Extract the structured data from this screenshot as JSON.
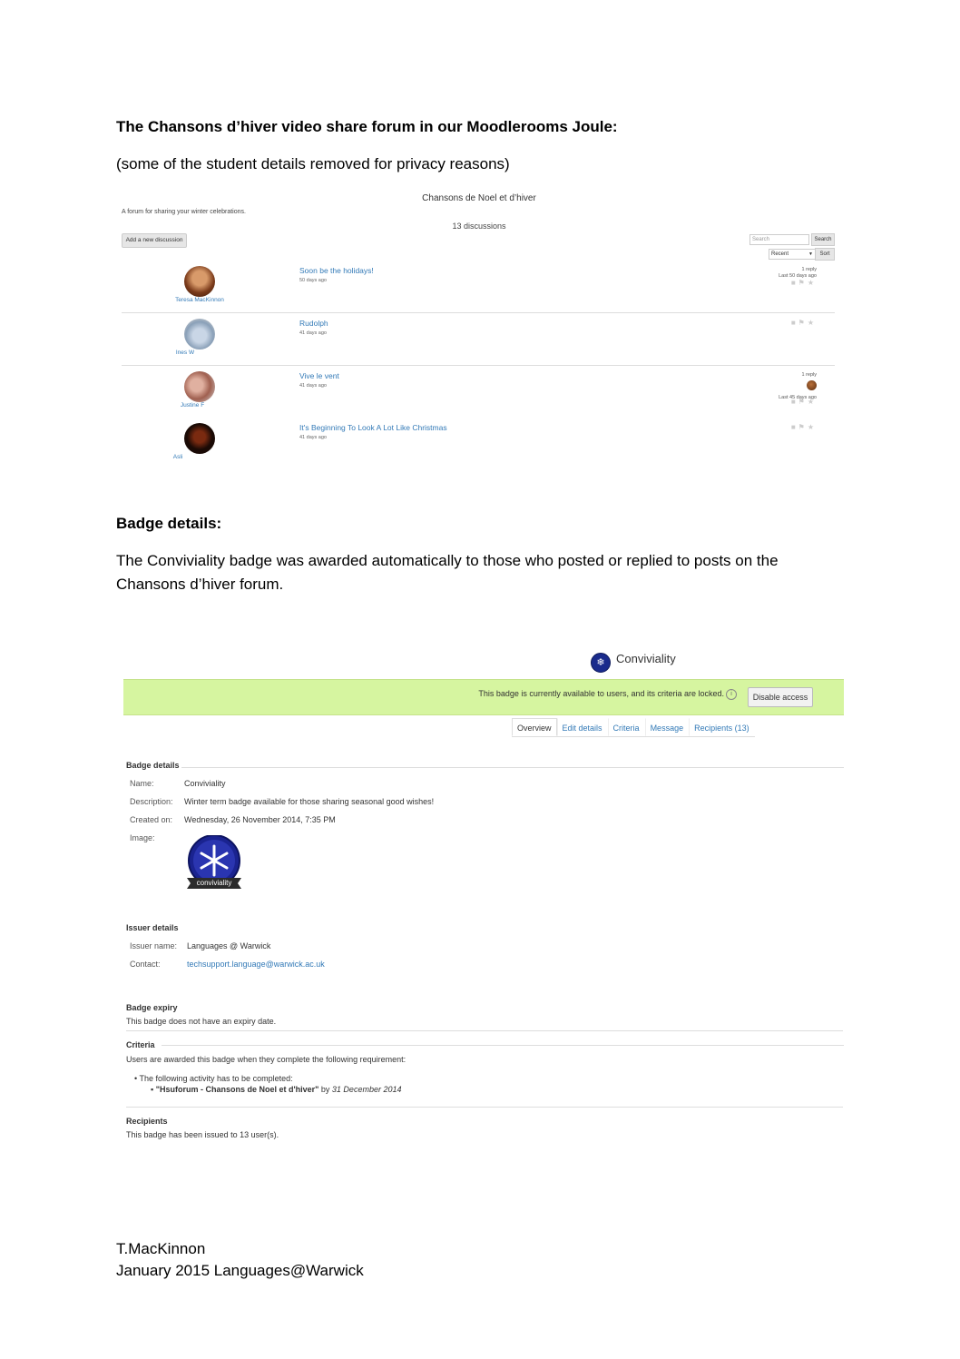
{
  "heading1": "The Chansons d’hiver video share forum in our Moodlerooms Joule:",
  "subheading1": "(some of the student details removed for privacy reasons)",
  "forum": {
    "title": "Chansons de Noel et d’hiver",
    "description": "A forum for sharing your winter celebrations.",
    "discussion_count": "13 discussions",
    "add_button": "Add a new discussion",
    "search_placeholder": "Search",
    "search_button": "Search",
    "sort_value": "Recent",
    "sort_button": "Sort",
    "discussions": [
      {
        "author": "Teresa MacKinnon",
        "title": "Soon be the holidays!",
        "ago": "50 days ago",
        "replies": "1 reply",
        "last": "Last 50 days ago"
      },
      {
        "author": "Ines W",
        "title": "Rudolph",
        "ago": "41 days ago",
        "replies": "",
        "last": ""
      },
      {
        "author": "Justine F",
        "title": "Vive le vent",
        "ago": "41 days ago",
        "replies": "1 reply",
        "last": "Last 45 days ago"
      },
      {
        "author": "Asli",
        "title": "It's Beginning To Look A Lot Like Christmas",
        "ago": "41 days ago",
        "replies": "",
        "last": ""
      }
    ]
  },
  "heading2": "Badge details:",
  "paragraph": "The Conviviality badge was awarded automatically to those who posted or replied to posts on the Chansons d’hiver forum.",
  "badge": {
    "title": "Conviviality",
    "status_message": "This badge is currently available to users, and its criteria are locked.",
    "disable_button": "Disable access",
    "tabs": [
      "Overview",
      "Edit details",
      "Criteria",
      "Message",
      "Recipients (13)"
    ],
    "details_heading": "Badge details",
    "name_label": "Name:",
    "name_value": "Conviviality",
    "description_label": "Description:",
    "description_value": "Winter term badge available for those sharing seasonal good wishes!",
    "created_label": "Created on:",
    "created_value": "Wednesday, 26 November 2014, 7:35 PM",
    "image_label": "Image:",
    "image_caption": "conviviality",
    "issuer_heading": "Issuer details",
    "issuer_name_label": "Issuer name:",
    "issuer_name_value": "Languages @ Warwick",
    "contact_label": "Contact:",
    "contact_value": "techsupport.language@warwick.ac.uk",
    "expiry_heading": "Badge expiry",
    "expiry_text": "This badge does not have an expiry date.",
    "criteria_heading": "Criteria",
    "criteria_text": "Users are awarded this badge when they complete the following requirement:",
    "criteria_bullet": "The following activity has to be completed:",
    "criteria_sub_bullet_bold": "\"Hsuforum - Chansons de Noel et d'hiver\"",
    "criteria_sub_bullet_by": " by ",
    "criteria_sub_bullet_date": "31 December 2014",
    "recipients_heading": "Recipients",
    "recipients_text": "This badge has been issued to 13 user(s)."
  },
  "footer": {
    "line1": "T.MacKinnon",
    "line2": "January 2015 Languages@Warwick"
  }
}
